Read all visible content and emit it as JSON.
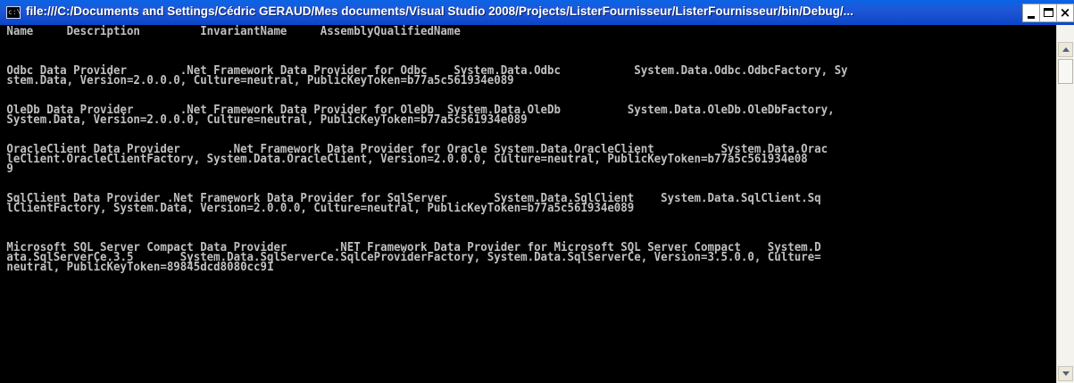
{
  "window": {
    "title": "file:///C:/Documents and Settings/Cédric GERAUD/Mes documents/Visual Studio 2008/Projects/ListerFournisseur/ListerFournisseur/bin/Debug/...",
    "icon": "console-icon",
    "controls": {
      "minimize": "minimize-icon",
      "maximize": "maximize-icon",
      "close": "×"
    }
  },
  "console": {
    "lines": [
      "Name     Description         InvariantName     AssemblyQualifiedName",
      "",
      "",
      "",
      "Odbc Data Provider        .Net Framework Data Provider for Odbc    System.Data.Odbc           System.Data.Odbc.OdbcFactory, Sy",
      "stem.Data, Version=2.0.0.0, Culture=neutral, PublicKeyToken=b77a5c561934e089",
      "",
      "",
      "OleDb Data Provider       .Net Framework Data Provider for OleDb  System.Data.OleDb          System.Data.OleDb.OleDbFactory,",
      "System.Data, Version=2.0.0.0, Culture=neutral, PublicKeyToken=b77a5c561934e089",
      "",
      "",
      "OracleClient Data Provider       .Net Framework Data Provider for Oracle System.Data.OracleClient          System.Data.Orac",
      "leClient.OracleClientFactory, System.Data.OracleClient, Version=2.0.0.0, Culture=neutral, PublicKeyToken=b77a5c561934e08",
      "9",
      "",
      "",
      "SqlClient Data Provider .Net Framework Data Provider for SqlServer       System.Data.SqlClient    System.Data.SqlClient.Sq",
      "lClientFactory, System.Data, Version=2.0.0.0, Culture=neutral, PublicKeyToken=b77a5c561934e089",
      "",
      "",
      "",
      "Microsoft SQL Server Compact Data Provider       .NET Framework Data Provider for Microsoft SQL Server Compact    System.D",
      "ata.SqlServerCe.3.5       System.Data.SqlServerCe.SqlCeProviderFactory, System.Data.SqlServerCe, Version=3.5.0.0, Culture=",
      "neutral, PublicKeyToken=89845dcd8080cc91",
      "",
      "",
      "",
      "",
      "",
      "",
      "",
      "",
      "",
      ""
    ]
  }
}
